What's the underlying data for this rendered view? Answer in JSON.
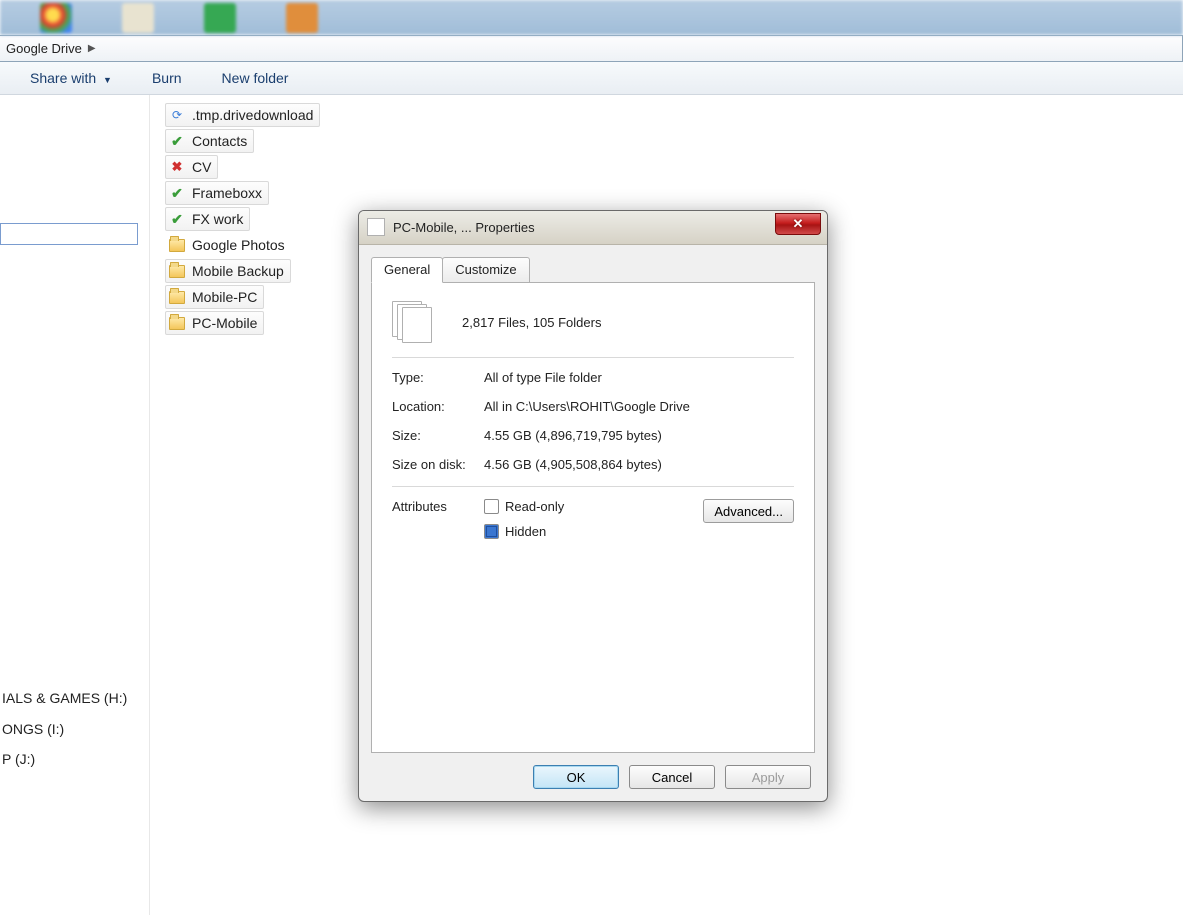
{
  "breadcrumb": {
    "root": "Google Drive"
  },
  "toolbar": {
    "share": "Share with",
    "burn": "Burn",
    "newfolder": "New folder"
  },
  "drives": {
    "a": "IALS & GAMES (H:)",
    "b": "ONGS (I:)",
    "c": "P  (J:)"
  },
  "files": [
    {
      "name": ".tmp.drivedownload",
      "icon": "sync",
      "boxed": true
    },
    {
      "name": "Contacts",
      "icon": "check",
      "boxed": true
    },
    {
      "name": "CV",
      "icon": "err",
      "boxed": true
    },
    {
      "name": "Frameboxx",
      "icon": "check",
      "boxed": true
    },
    {
      "name": "FX work",
      "icon": "check",
      "boxed": true
    },
    {
      "name": "Google Photos",
      "icon": "folder",
      "boxed": false
    },
    {
      "name": "Mobile Backup",
      "icon": "folder",
      "boxed": true
    },
    {
      "name": "Mobile-PC",
      "icon": "folder",
      "boxed": true
    },
    {
      "name": "PC-Mobile",
      "icon": "folder",
      "boxed": true
    }
  ],
  "dialog": {
    "title": "PC-Mobile, ... Properties",
    "tabs": {
      "general": "General",
      "customize": "Customize"
    },
    "summary": "2,817 Files, 105 Folders",
    "labels": {
      "type": "Type:",
      "location": "Location:",
      "size": "Size:",
      "sizeondisk": "Size on disk:",
      "attributes": "Attributes"
    },
    "values": {
      "type": "All of type File folder",
      "location": "All in C:\\Users\\ROHIT\\Google Drive",
      "size": "4.55 GB (4,896,719,795 bytes)",
      "sizeondisk": "4.56 GB (4,905,508,864 bytes)"
    },
    "checks": {
      "readonly": "Read-only",
      "hidden": "Hidden"
    },
    "advanced": "Advanced...",
    "buttons": {
      "ok": "OK",
      "cancel": "Cancel",
      "apply": "Apply"
    }
  }
}
